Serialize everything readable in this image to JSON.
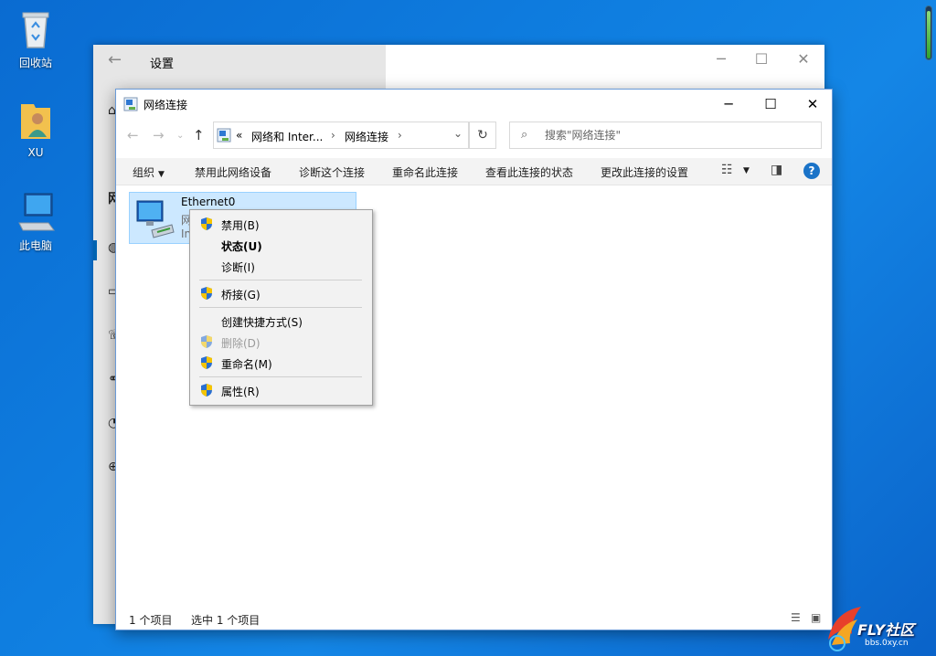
{
  "desktop": {
    "icons": [
      {
        "label": "回收站"
      },
      {
        "label": "XU"
      },
      {
        "label": "此电脑"
      }
    ]
  },
  "settings_window": {
    "title": "设置",
    "partial_sidebar_text": "网"
  },
  "explorer": {
    "title": "网络连接",
    "address": {
      "overflow": "«",
      "segments": [
        "网络和 Inter...",
        "网络连接"
      ]
    },
    "search_placeholder": "搜索\"网络连接\"",
    "commands": {
      "organize": "组织",
      "disable": "禁用此网络设备",
      "diagnose": "诊断这个连接",
      "rename": "重命名此连接",
      "view_status": "查看此连接的状态",
      "change_settings": "更改此连接的设置"
    },
    "item": {
      "name": "Ethernet0",
      "line2_partial": "网",
      "line3_partial": "In"
    },
    "status": {
      "count": "1 个项目",
      "selected": "选中 1 个项目"
    }
  },
  "context_menu": {
    "items": [
      {
        "label": "禁用(B)",
        "shield": true
      },
      {
        "label": "状态(U)",
        "bold": true
      },
      {
        "label": "诊断(I)"
      },
      {
        "label": "桥接(G)",
        "shield": true
      },
      {
        "label": "创建快捷方式(S)"
      },
      {
        "label": "删除(D)",
        "shield": true,
        "disabled": true
      },
      {
        "label": "重命名(M)",
        "shield": true
      },
      {
        "label": "属性(R)",
        "shield": true
      }
    ]
  },
  "watermark": {
    "logo_text": "FLY社区",
    "url": "bbs.0xy.cn"
  },
  "colors": {
    "desktop_blue": "#0f7ee0",
    "selection": "#cce8ff",
    "accent": "#0063b1",
    "shield_blue": "#2a6fd1",
    "shield_yellow": "#f5c400"
  }
}
